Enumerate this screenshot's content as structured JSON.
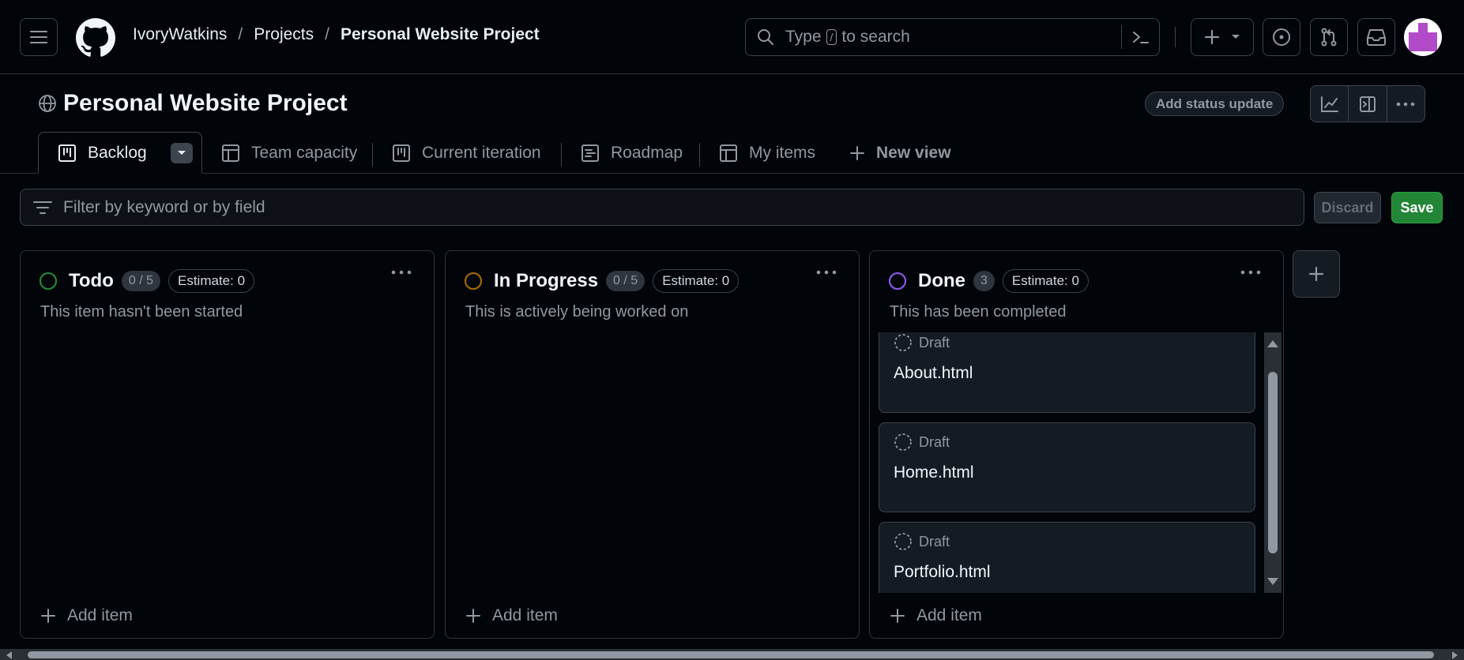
{
  "header": {
    "breadcrumbs": [
      "IvoryWatkins",
      "Projects",
      "Personal Website Project"
    ],
    "separator": "/",
    "search": {
      "prefix": "Type",
      "key": "/",
      "suffix": "to search"
    }
  },
  "project": {
    "title": "Personal Website Project",
    "status_button": "Add status update"
  },
  "tabs": [
    {
      "label": "Backlog",
      "icon": "board-icon",
      "active": true
    },
    {
      "label": "Team capacity",
      "icon": "table-icon"
    },
    {
      "label": "Current iteration",
      "icon": "board-icon"
    },
    {
      "label": "Roadmap",
      "icon": "roadmap-icon"
    },
    {
      "label": "My items",
      "icon": "table-icon"
    },
    {
      "label": "New view",
      "icon": "plus-icon"
    }
  ],
  "filter": {
    "placeholder": "Filter by keyword or by field",
    "discard_label": "Discard",
    "save_label": "Save"
  },
  "columns": [
    {
      "name": "Todo",
      "count": "0 / 5",
      "estimate": "Estimate: 0",
      "description": "This item hasn't been started",
      "status_color": "#238636",
      "add_label": "Add item",
      "cards": []
    },
    {
      "name": "In Progress",
      "count": "0 / 5",
      "estimate": "Estimate: 0",
      "description": "This is actively being worked on",
      "status_color": "#9e6a03",
      "add_label": "Add item",
      "cards": []
    },
    {
      "name": "Done",
      "count": "3",
      "estimate": "Estimate: 0",
      "description": "This has been completed",
      "status_color": "#8957e5",
      "add_label": "Add item",
      "cards": [
        {
          "type": "Draft",
          "title": "About.html"
        },
        {
          "type": "Draft",
          "title": "Home.html"
        },
        {
          "type": "Draft",
          "title": "Portfolio.html"
        }
      ]
    }
  ],
  "colors": {
    "background": "#010409",
    "border": "#30363d",
    "save_green": "#238636",
    "avatar_accent": "#b24bc9"
  }
}
